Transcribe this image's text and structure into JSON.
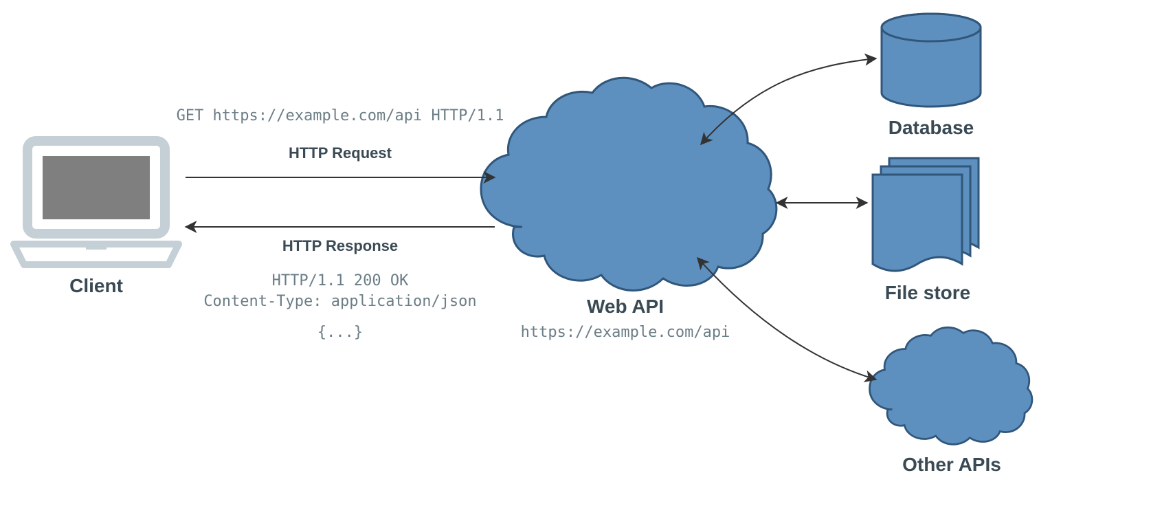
{
  "nodes": {
    "client": {
      "label": "Client"
    },
    "webapi": {
      "label": "Web API",
      "url": "https://example.com/api"
    },
    "database": {
      "label": "Database"
    },
    "filestore": {
      "label": "File store"
    },
    "otherapis": {
      "label": "Other APIs"
    }
  },
  "request": {
    "line": "GET https://example.com/api HTTP/1.1",
    "label": "HTTP Request"
  },
  "response": {
    "label": "HTTP Response",
    "status": "HTTP/1.1 200 OK",
    "content_type": "Content-Type: application/json",
    "body": "{...}"
  },
  "colors": {
    "shape_fill": "#5d8fbf",
    "shape_stroke": "#30567a",
    "client_gray": "#7f7f7f",
    "client_outline": "#c4cfd6",
    "text_dark": "#3a4a54",
    "text_mono": "#6b7d86"
  }
}
